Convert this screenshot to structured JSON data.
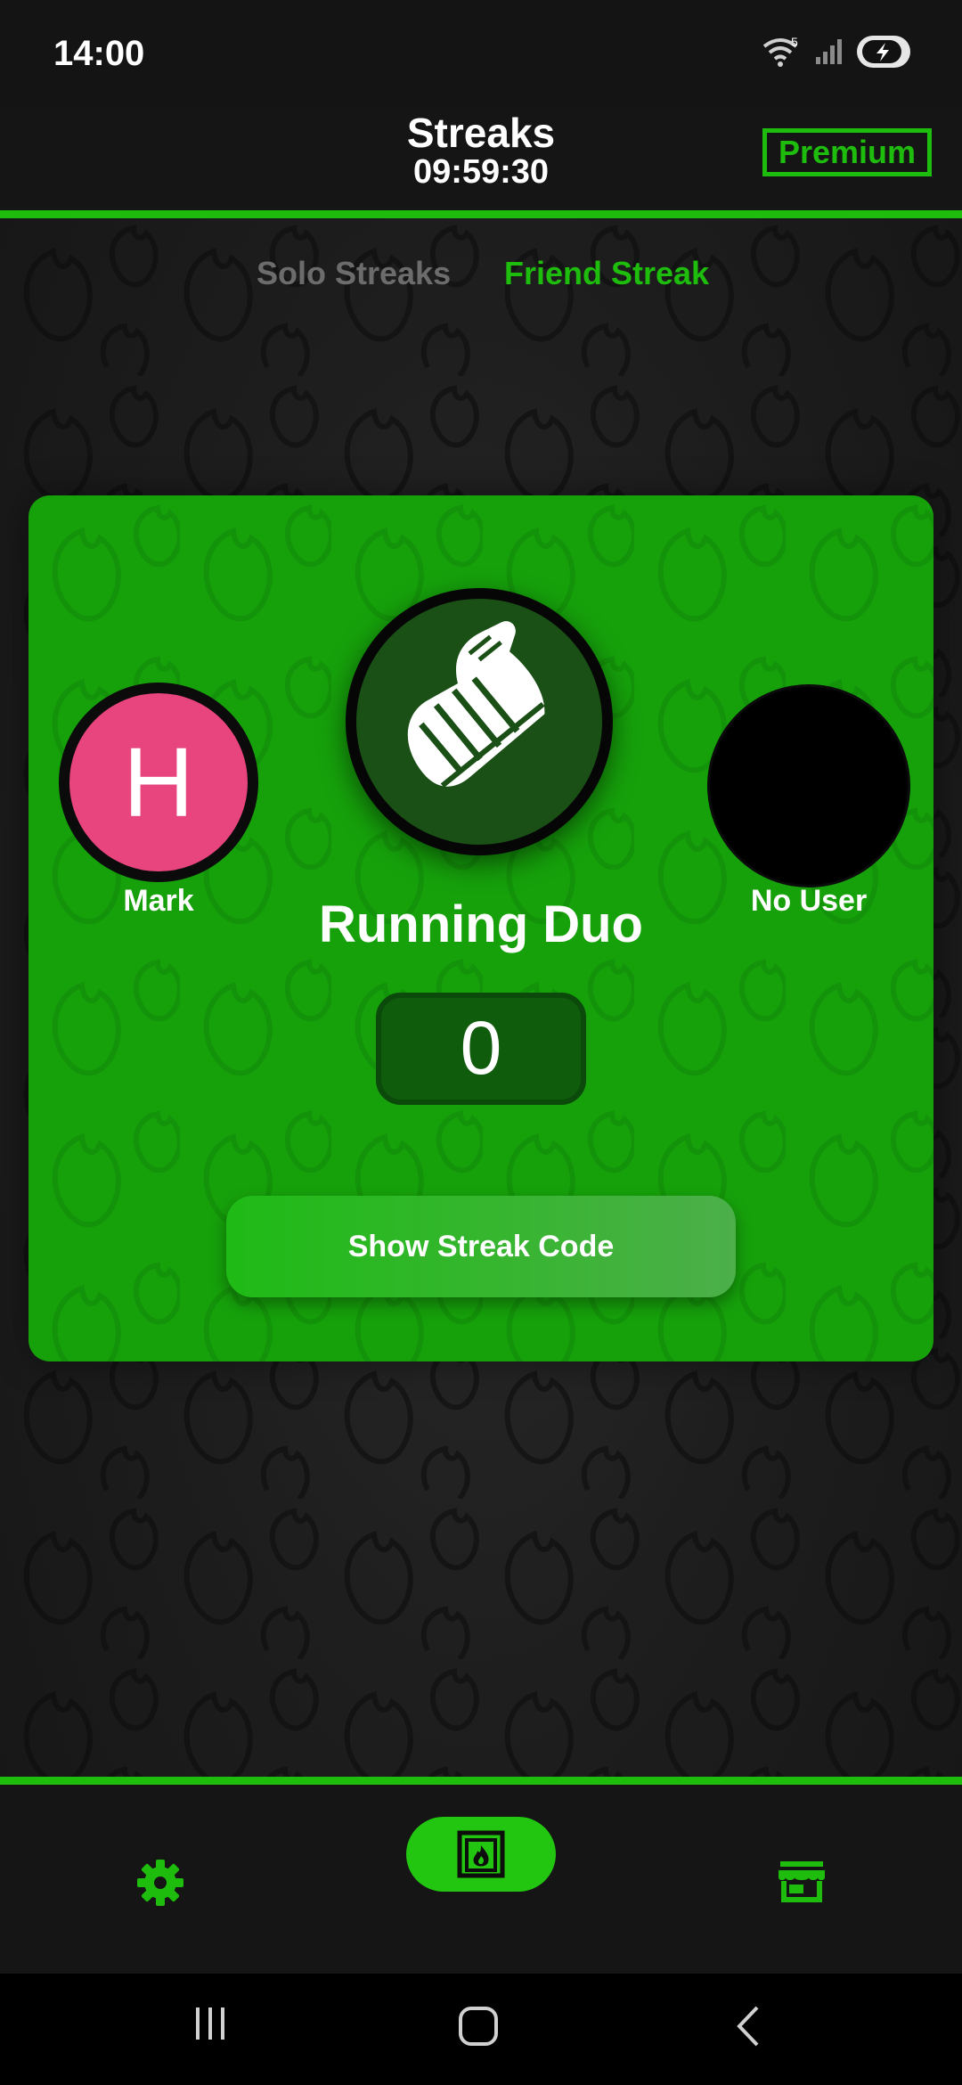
{
  "status_bar": {
    "time": "14:00",
    "wifi_badge": "5"
  },
  "header": {
    "title": "Streaks",
    "timer": "09:59:30",
    "premium_label": "Premium"
  },
  "tabs": [
    {
      "label": "Solo Streaks",
      "active": false
    },
    {
      "label": "Friend Streak",
      "active": true
    }
  ],
  "card": {
    "left_user": {
      "initial": "H",
      "name": "Mark",
      "avatar_color": "#e8457e"
    },
    "right_user": {
      "name": "No User"
    },
    "streak_icon": "running-shoe-icon",
    "streak_name": "Running Duo",
    "streak_count": "0",
    "button_label": "Show Streak Code"
  },
  "bottom_nav": [
    {
      "icon": "gear-icon",
      "active": false
    },
    {
      "icon": "fireplace-icon",
      "active": true
    },
    {
      "icon": "store-icon",
      "active": false
    }
  ],
  "colors": {
    "accent": "#1ebc0c",
    "card_bg": "#16a10b",
    "inactive_tab": "#6c6c6c",
    "background": "#1e1e1e"
  }
}
